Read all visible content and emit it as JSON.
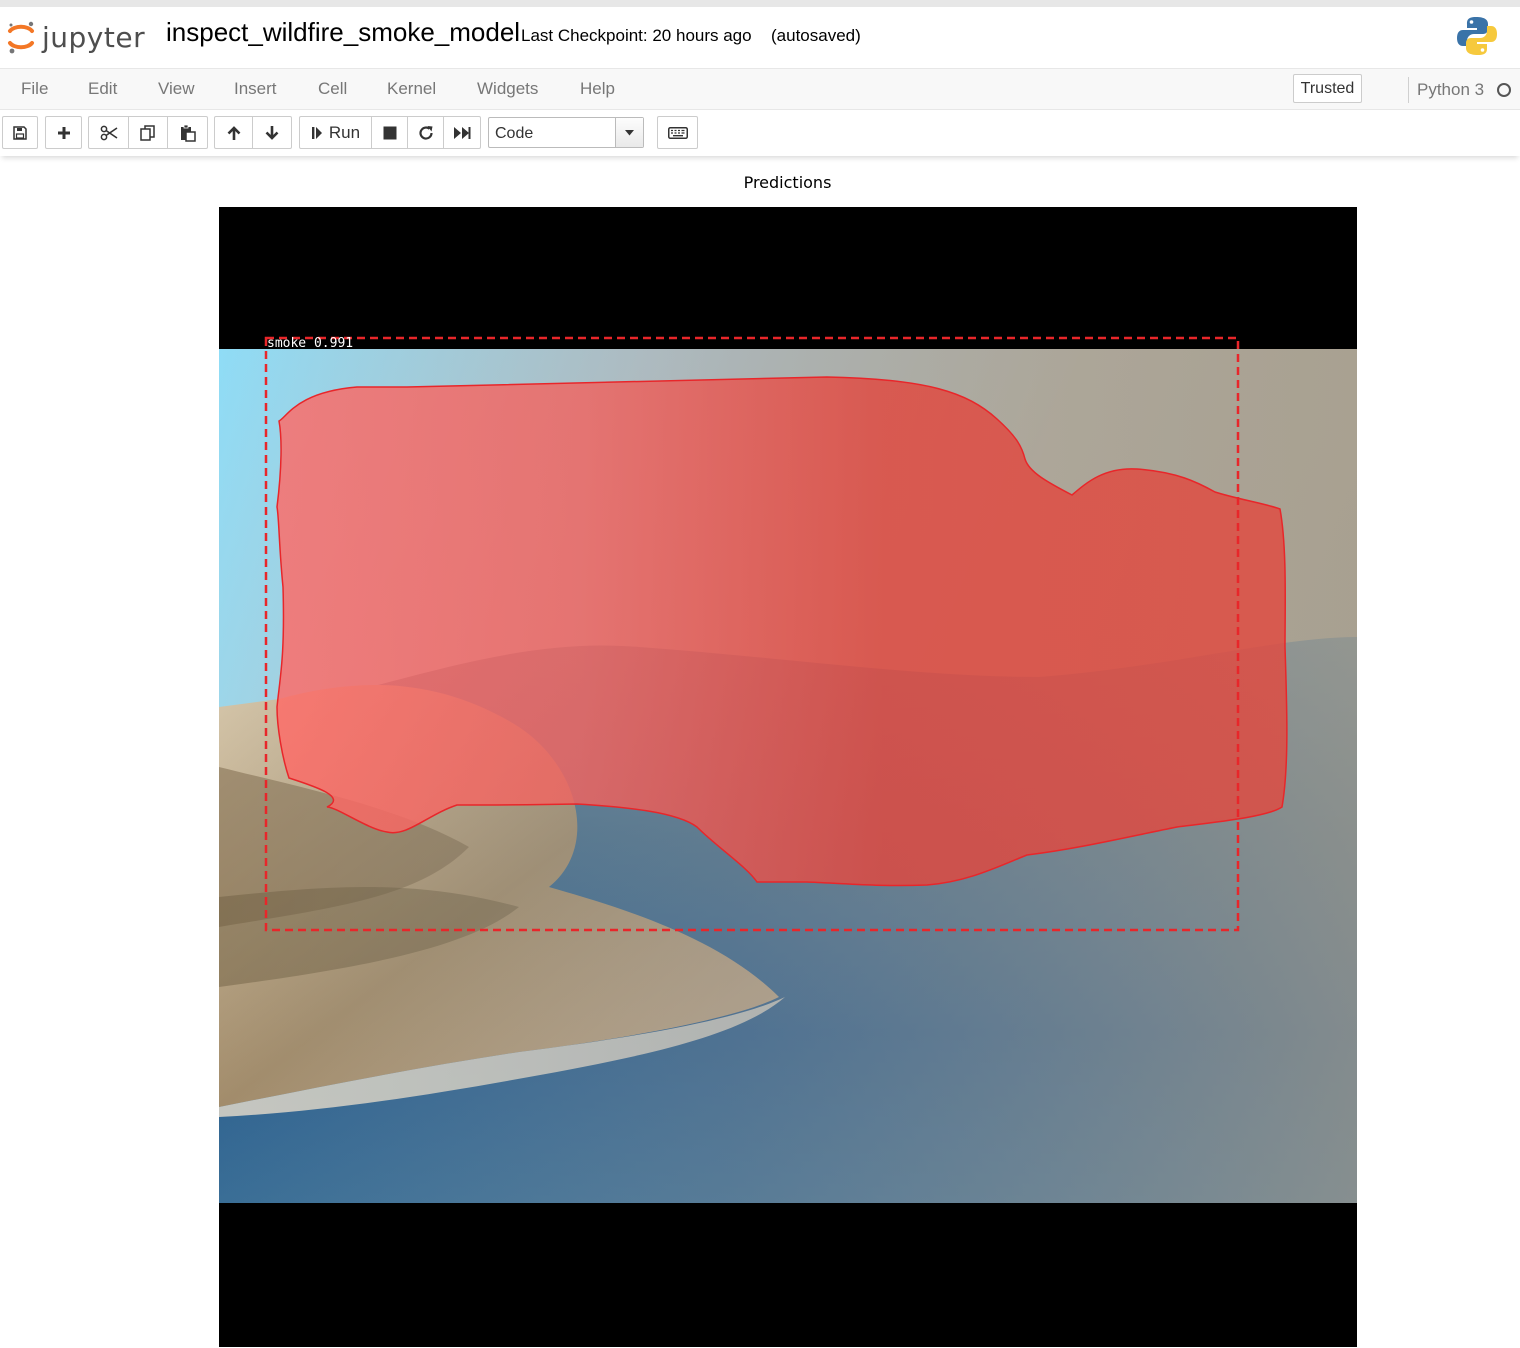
{
  "header": {
    "logo_text": "jupyter",
    "notebook_title": "inspect_wildfire_smoke_model",
    "checkpoint_text": "Last Checkpoint: 20 hours ago",
    "autosave_text": "(autosaved)"
  },
  "menubar": {
    "items": [
      "File",
      "Edit",
      "View",
      "Insert",
      "Cell",
      "Kernel",
      "Widgets",
      "Help"
    ],
    "trusted_label": "Trusted",
    "kernel_name": "Python 3"
  },
  "toolbar": {
    "run_label": "Run",
    "cell_type": "Code",
    "icons": [
      "save-icon",
      "plus-icon",
      "cut-icon",
      "copy-icon",
      "paste-icon",
      "arrow-up-icon",
      "arrow-down-icon",
      "step-forward-icon",
      "stop-icon",
      "restart-icon",
      "fast-forward-icon",
      "keyboard-icon"
    ]
  },
  "output": {
    "title": "Predictions",
    "detection_label": "smoke 0.991",
    "colors": {
      "mask": "#ff3b30",
      "box": "#e8262a",
      "letterbox": "#000000"
    }
  }
}
